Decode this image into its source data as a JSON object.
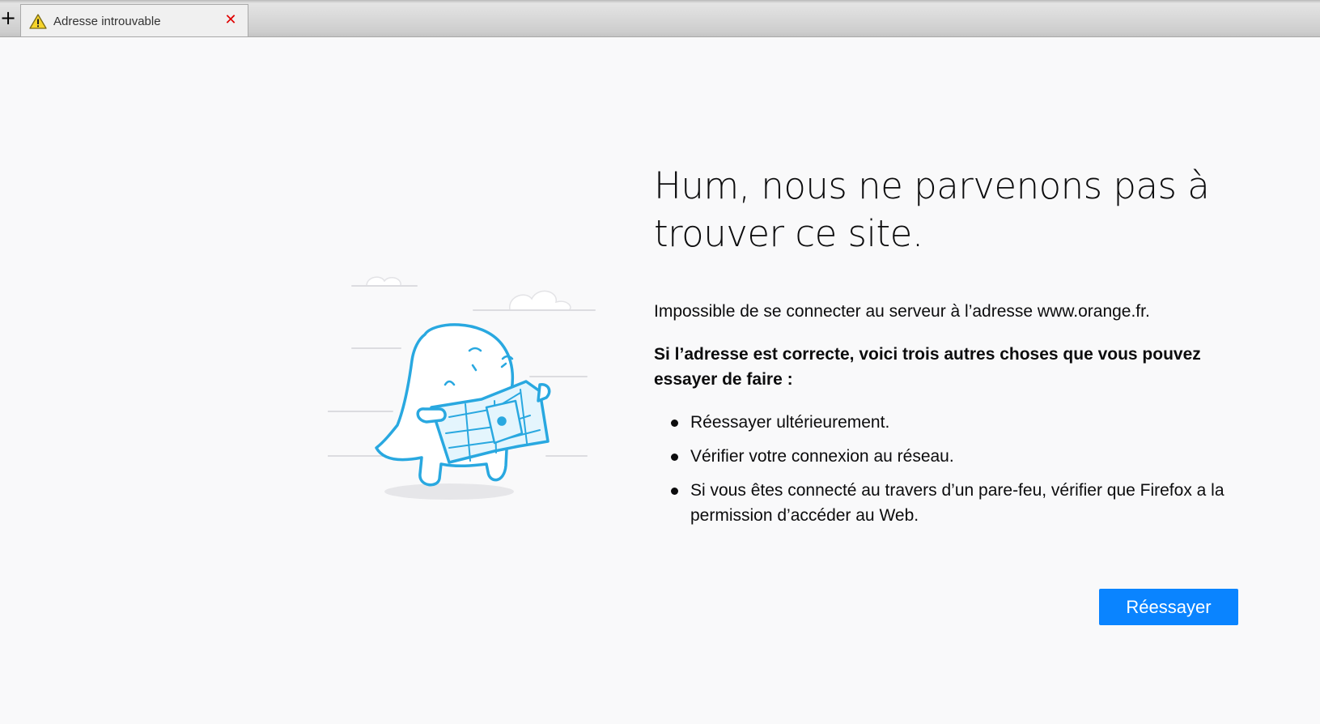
{
  "browser": {
    "new_tab_glyph": "+",
    "tab": {
      "title": "Adresse introuvable",
      "icon": "warning-icon",
      "close_glyph": "✕"
    }
  },
  "error_page": {
    "title": "Hum, nous ne parvenons pas à trouver ce site.",
    "description": "Impossible de se connecter au serveur à l’adresse www.orange.fr.",
    "suggestions_intro": "Si l’adresse est correcte, voici trois autres choses que vous pouvez essayer de faire :",
    "suggestions": [
      "Réessayer ultérieurement.",
      "Vérifier votre connexion au réseau.",
      "Si vous êtes connecté au travers d’un pare-feu, vérifier que Firefox a la permission d’accéder au Web."
    ],
    "retry_button": "Réessayer",
    "illustration": "confused-map-monster-illustration"
  },
  "colors": {
    "accent": "#0a84ff",
    "illustration_stroke": "#29a8e0",
    "illustration_fill": "#e4f5fd",
    "close": "#e00000",
    "background": "#f9f9fa"
  }
}
